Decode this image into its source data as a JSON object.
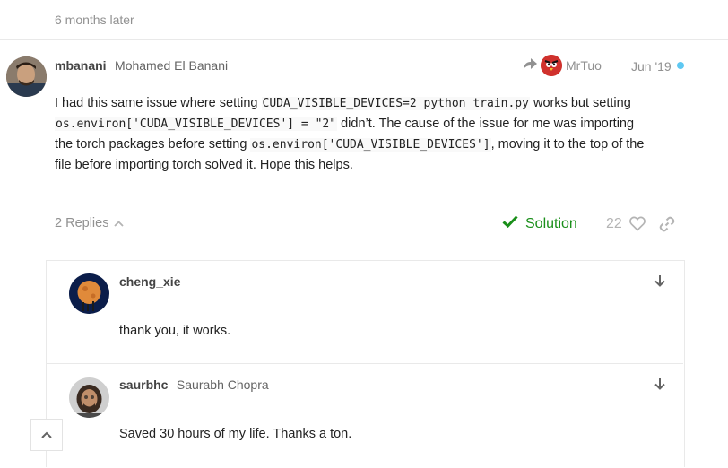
{
  "time_gap": "6 months later",
  "post": {
    "username": "mbanani",
    "full_name": "Mohamed El Banani",
    "reply_to_user": "MrTuo",
    "date": "Jun '19",
    "body": {
      "p1_a": "I had this same issue where setting ",
      "p1_code1": "CUDA_VISIBLE_DEVICES=2 python train.py",
      "p1_b": " works but setting",
      "p2_code1": "os.environ['CUDA_VISIBLE_DEVICES'] = \"2\"",
      "p2_b": " didn’t. The cause of the issue for me was importing",
      "p3_a": "the torch packages before setting ",
      "p3_code1": "os.environ['CUDA_VISIBLE_DEVICES']",
      "p3_b": ", moving it to the top of the",
      "p4": "file before importing torch solved it. Hope this helps."
    },
    "replies_label": "2 Replies",
    "solution_label": "Solution",
    "like_count": "22"
  },
  "replies": [
    {
      "username": "cheng_xie",
      "full_name": "",
      "text": "thank you, it works."
    },
    {
      "username": "saurbhc",
      "full_name": "Saurabh Chopra",
      "text": "Saved 30 hours of my life. Thanks a ton."
    }
  ],
  "colors": {
    "solution_green": "#1a8f1a",
    "new_dot": "#5ec8f2",
    "muted": "#919191"
  },
  "icons": [
    "share-reply-icon",
    "check-icon",
    "heart-icon",
    "link-icon",
    "chevron-up-icon",
    "arrow-down-icon"
  ]
}
